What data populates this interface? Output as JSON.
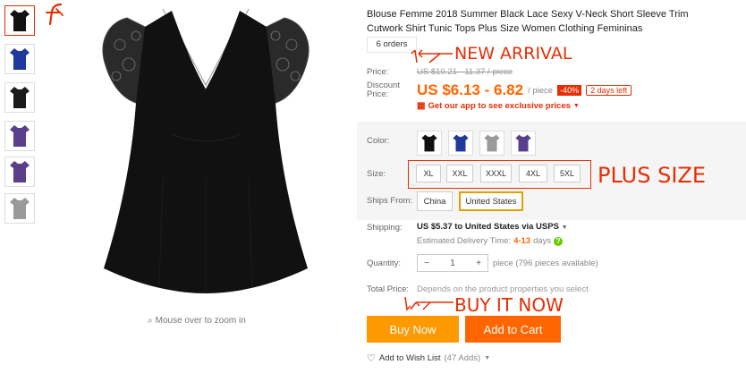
{
  "gallery": {
    "thumbnails": [
      {
        "color": "#111111"
      },
      {
        "color": "#1f3a9c"
      },
      {
        "color": "#1a1a1a"
      },
      {
        "color": "#5a3f8c"
      },
      {
        "color": "#5b3f8a"
      },
      {
        "color": "#9a9a9a"
      }
    ],
    "zoom_hint": "Mouse over to zoom in"
  },
  "product": {
    "title": "Blouse Femme 2018 Summer Black Lace Sexy V-Neck Short Sleeve Trim Cutwork Shirt Tunic Tops Plus Size Women Clothing Femininas",
    "orders": "6 orders",
    "price_label": "Price:",
    "old_price": "US $10.21 - 11.37 / piece",
    "discount_label": "Discount Price:",
    "current_price": "US $6.13 - 6.82",
    "per_piece": "/ piece",
    "discount": "-40%",
    "days_left": "2 days left",
    "app_promo": "Get our app to see exclusive prices"
  },
  "options": {
    "color_label": "Color:",
    "swatches": [
      {
        "color": "#111111"
      },
      {
        "color": "#1f3a9c"
      },
      {
        "color": "#9a9a9a"
      },
      {
        "color": "#5a3f8c"
      }
    ],
    "size_label": "Size:",
    "sizes": [
      "XL",
      "XXL",
      "XXXL",
      "4XL",
      "5XL"
    ],
    "ships_label": "Ships From:",
    "ships_from": [
      "China",
      "United States"
    ],
    "shipping_label": "Shipping:",
    "shipping_main": "US $5.37 to United States via USPS",
    "delivery_prefix": "Estimated Delivery Time:",
    "delivery_days": "4-13",
    "delivery_suffix": "days",
    "quantity_label": "Quantity:",
    "quantity_value": "1",
    "quantity_minus": "−",
    "quantity_plus": "+",
    "quantity_note": "piece (796 pieces available)",
    "total_label": "Total Price:",
    "total_note": "Depends on the product properties you select"
  },
  "actions": {
    "buy_now": "Buy Now",
    "add_to_cart": "Add to Cart",
    "wish_list": "Add to Wish List",
    "wish_count": "(47 Adds)"
  },
  "annotations": {
    "new_arrival": "NEW ARRIVAL",
    "plus_size": "PLUS SIZE",
    "buy_it_now": "BUY IT NOW"
  },
  "colors": {
    "accent_red": "#e62e04",
    "price_orange": "#ff6600",
    "buy_now_bg": "#ff9900",
    "cart_bg": "#ff6600"
  }
}
